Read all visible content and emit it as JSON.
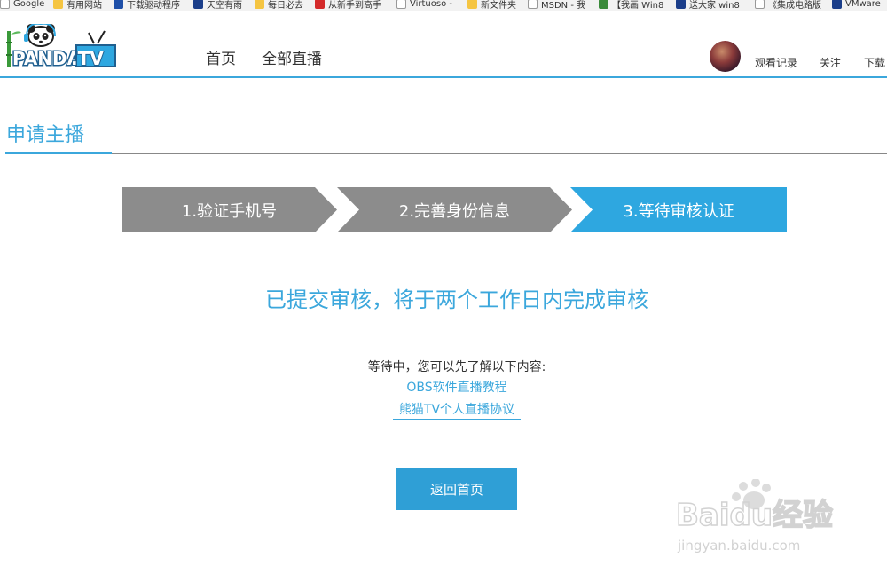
{
  "bookmarks": [
    {
      "label": "Google",
      "icon": "page-icon"
    },
    {
      "label": "有用网站",
      "icon": "folder-icon"
    },
    {
      "label": "下载驱动程序",
      "icon": "hp-icon"
    },
    {
      "label": "天空有雨",
      "icon": "site-icon"
    },
    {
      "label": "每日必去",
      "icon": "folder-icon"
    },
    {
      "label": "从新手到高手",
      "icon": "red-site-icon"
    },
    {
      "label": "Virtuoso -",
      "icon": "page-icon"
    },
    {
      "label": "新文件夹",
      "icon": "folder-icon"
    },
    {
      "label": "MSDN - 我",
      "icon": "page-icon"
    },
    {
      "label": "【我画 Win8",
      "icon": "green-site-icon"
    },
    {
      "label": "送大家 win8",
      "icon": "site-icon"
    },
    {
      "label": "《集成电路版",
      "icon": "page-icon"
    },
    {
      "label": "VMware",
      "icon": "vmware-icon"
    }
  ],
  "header": {
    "logo_text": "PANDA.TV",
    "nav": [
      "首页",
      "全部直播"
    ],
    "links": [
      "观看记录",
      "关注",
      "下载"
    ]
  },
  "section_title": "申请主播",
  "steps": [
    {
      "label": "1.验证手机号",
      "state": "done",
      "color": "#8c8c8c"
    },
    {
      "label": "2.完善身份信息",
      "state": "done",
      "color": "#8c8c8c"
    },
    {
      "label": "3.等待审核认证",
      "state": "active",
      "color": "#2ea7e0"
    }
  ],
  "headline": "已提交审核，将于两个工作日内完成审核",
  "waiting_text": "等待中，您可以先了解以下内容:",
  "links": [
    "OBS软件直播教程",
    "熊猫TV个人直播协议"
  ],
  "home_button": "返回首页",
  "watermark": {
    "brand": "Baidu经验",
    "url": "jingyan.baidu.com"
  },
  "colors": {
    "accent": "#3ba7dc",
    "step_done": "#8c8c8c",
    "button": "#2f9fd6"
  }
}
